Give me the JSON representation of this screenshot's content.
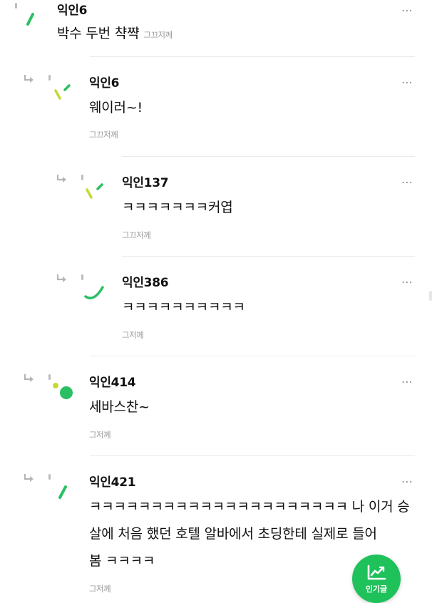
{
  "comments": [
    {
      "nick": "익인6",
      "text": "박수 두번 챡쨕",
      "time": "그끄저께",
      "more": "⋯"
    },
    {
      "nick": "익인6",
      "text": "웨이러~!",
      "time": "그끄저께",
      "more": "⋯"
    },
    {
      "nick": "익인137",
      "text": "ㅋㅋㅋㅋㅋㅋㅋ커엽",
      "time": "그끄저께",
      "more": "⋯"
    },
    {
      "nick": "익인386",
      "text": "ㅋㅋㅋㅋㅋㅋㅋㅋㅋㅋ",
      "time": "그저께",
      "more": "⋯"
    },
    {
      "nick": "익인414",
      "text": "세바스찬~",
      "time": "그저께",
      "more": "⋯"
    },
    {
      "nick": "익인421",
      "text_lines": [
        "ㅋㅋㅋㅋㅋㅋㅋㅋㅋㅋㅋㅋㅋㅋㅋㅋㅋㅋㅋㅋㅋ 나 이거 승",
        "살에 처음 했던 호텔 알바에서 초딩한테 실제로 들어",
        "봄 ㅋㅋㅋㅋ"
      ],
      "time": "그저께",
      "more": "⋯"
    }
  ],
  "popular_button": {
    "label": "인기글",
    "icon": "trending-chart-icon"
  },
  "colors": {
    "accent_green": "#1ec15a",
    "avatar_yellow": "#c6d932",
    "avatar_green": "#2bbf63",
    "meta_gray": "#9a9a9a"
  }
}
